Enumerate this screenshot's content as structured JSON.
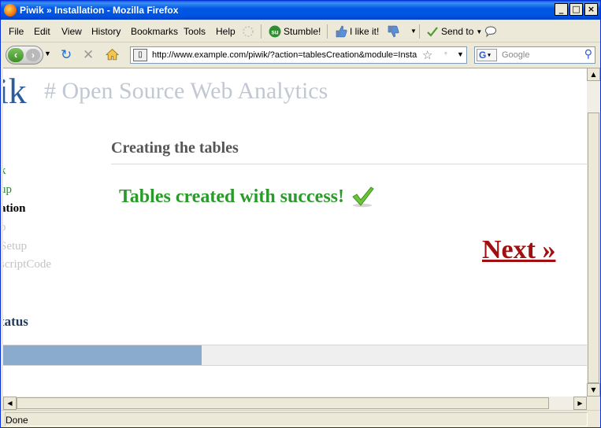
{
  "window": {
    "title": "Piwik » Installation - Mozilla Firefox",
    "controls": [
      "_",
      "□",
      "×"
    ]
  },
  "menu": {
    "items": [
      {
        "label": "File",
        "accesskey": "F"
      },
      {
        "label": "Edit",
        "accesskey": "E"
      },
      {
        "label": "View",
        "accesskey": "V"
      },
      {
        "label": "History",
        "accesskey": "s"
      },
      {
        "label": "Bookmarks",
        "accesskey": "B"
      },
      {
        "label": "Tools",
        "accesskey": "T"
      },
      {
        "label": "Help",
        "accesskey": "H"
      }
    ],
    "stumble_label": "Stumble!",
    "ilike_label": "I like it!",
    "sendto_label": "Send to"
  },
  "nav": {
    "url": "http://www.example.com/piwik/?action=tablesCreation&module=Insta",
    "search_placeholder": "Google",
    "search_engine_letter": "G"
  },
  "page": {
    "logo": "ik",
    "tagline": "# Open Source Web Analytics",
    "steps": [
      {
        "label": "k",
        "state": "done"
      },
      {
        "label": "up",
        "state": "done"
      },
      {
        "label": "ation",
        "state": "current"
      },
      {
        "label": "p",
        "state": "todo"
      },
      {
        "label": "Setup",
        "state": "todo"
      },
      {
        "label": "scriptCode",
        "state": "todo"
      }
    ],
    "status_label": "tatus",
    "progress_fraction": 0.34,
    "section_title": "Creating the tables",
    "success_message": "Tables created with success!",
    "next_label": "Next »"
  },
  "statusbar": {
    "text": "Done"
  },
  "colors": {
    "titlebar": "#0053e0",
    "logo": "#2d5b9b",
    "success": "#2a9a2a",
    "next": "#a01010",
    "progress": "#8aaace"
  }
}
